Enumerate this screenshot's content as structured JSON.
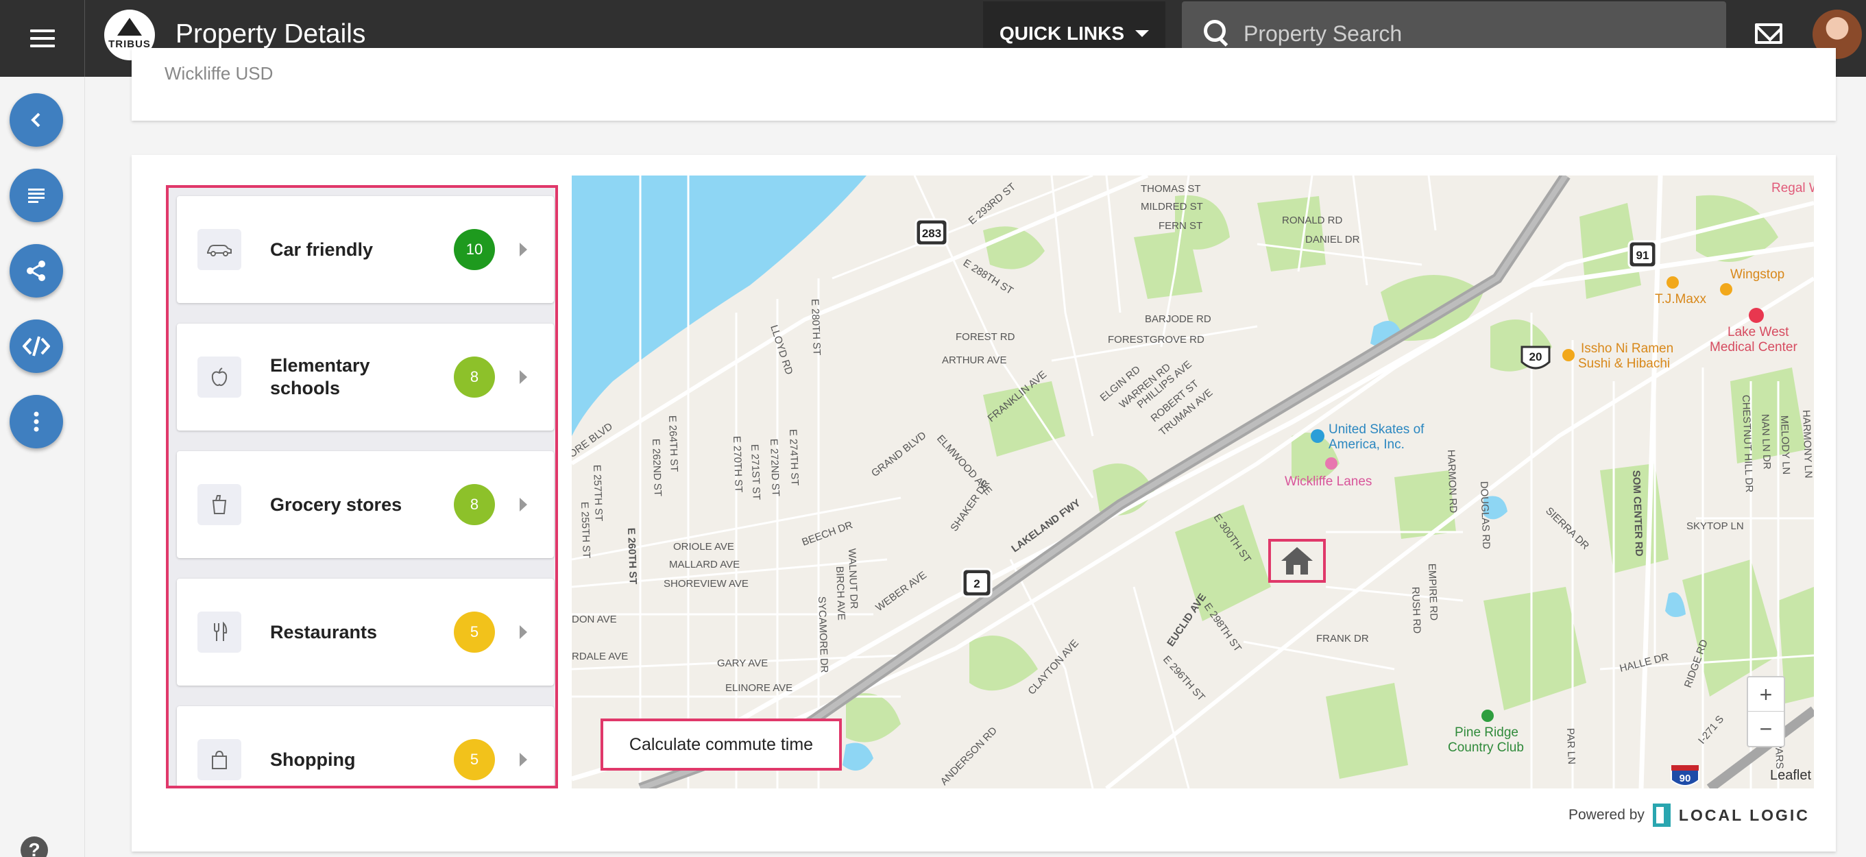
{
  "header": {
    "logo_text": "TRIBUS",
    "title": "Property Details",
    "quick_links_label": "QUICK LINKS",
    "search_placeholder": "Property Search"
  },
  "sidebar": {
    "buttons": [
      "back",
      "details",
      "share",
      "embed",
      "more"
    ]
  },
  "top_card": {
    "faded_text": "Wickliffe USD"
  },
  "categories": [
    {
      "label": "Car friendly",
      "score": "10",
      "color": "#1e9a1e",
      "icon": "car-icon"
    },
    {
      "label": "Elementary schools",
      "score": "8",
      "color": "#8dc12a",
      "icon": "apple-icon"
    },
    {
      "label": "Grocery stores",
      "score": "8",
      "color": "#8dc12a",
      "icon": "grocery-bag-icon"
    },
    {
      "label": "Restaurants",
      "score": "5",
      "color": "#f2c21b",
      "icon": "fork-knife-icon"
    },
    {
      "label": "Shopping",
      "score": "5",
      "color": "#f2c21b",
      "icon": "shopping-bag-icon"
    }
  ],
  "map": {
    "commute_button": "Calculate commute time",
    "attribution": "Leaflet",
    "zoom_in": "+",
    "zoom_out": "−",
    "highway_shields": [
      "283",
      "91",
      "20",
      "2",
      "90"
    ],
    "pois": {
      "regal": "Regal W",
      "wingstop": "Wingstop",
      "tjmaxx": "T.J.Maxx",
      "lakewest1": "Lake West",
      "lakewest2": "Medical Center",
      "issho1": "Issho Ni Ramen",
      "issho2": "Sushi & Hibachi",
      "skates1": "United Skates of",
      "skates2": "America, Inc.",
      "lanes": "Wickliffe Lanes",
      "pineridge1": "Pine Ridge",
      "pineridge2": "Country Club"
    },
    "streets": {
      "thomas": "THOMAS ST",
      "mildred": "MILDRED ST",
      "fern": "FERN ST",
      "ronald": "RONALD RD",
      "daniel": "DANIEL DR",
      "e293": "E 293RD ST",
      "e288": "E 288TH ST",
      "barjode": "BARJODE RD",
      "forest": "FOREST RD",
      "forestgrove": "FORESTGROVE RD",
      "arthur": "ARTHUR AVE",
      "franklin": "FRANKLIN AVE",
      "elgin": "ELGIN RD",
      "warren": "WARREN RD",
      "phillips": "PHILLIPS AVE",
      "robert": "ROBERT ST",
      "truman": "TRUMAN AVE",
      "lloyd": "LLOYD RD",
      "e280": "E 280TH ST",
      "grand": "GRAND BLVD",
      "elmwood": "ELMWOOD AVE",
      "shaker": "SHAKER DR",
      "lakeland": "LAKELAND FWY",
      "lakeshore": "ORE BLVD",
      "e264": "E 264TH ST",
      "e262": "E 262ND ST",
      "e270": "E 270TH ST",
      "e271": "E 271ST ST",
      "e272": "E 272ND ST",
      "e274": "E 274TH ST",
      "e257": "E 257TH ST",
      "e255": "E 255TH ST",
      "e260": "E 260TH ST",
      "oriole": "ORIOLE AVE",
      "mallard": "MALLARD AVE",
      "shoreview": "SHOREVIEW AVE",
      "beech": "BEECH DR",
      "walnut": "WALNUT DR",
      "birch": "BIRCH AVE",
      "sycamore": "SYCAMORE DR",
      "weber": "WEBER AVE",
      "gary": "GARY AVE",
      "elinore": "ELINORE AVE",
      "don": "DON AVE",
      "rdale": "RDALE AVE",
      "clayton": "CLAYTON AVE",
      "anderson": "ANDERSON RD",
      "euclid": "EUCLID AVE",
      "e300": "E 300TH ST",
      "e298": "E 298TH ST",
      "e296": "E 296TH ST",
      "frank": "FRANK DR",
      "rush": "RUSH RD",
      "empire": "EMPIRE RD",
      "harmon": "HARMON RD",
      "douglas": "DOUGLAS RD",
      "sierra": "SIERRA DR",
      "som": "SOM CENTER RD",
      "skytop": "SKYTOP LN",
      "halle": "HALLE DR",
      "ridge": "RIDGE RD",
      "i271": "I-271 S",
      "chestnut": "CHESTNUT HILL DR",
      "nan": "NAN LN DR",
      "melody": "MELODY LN",
      "harmony": "HARMONY LN",
      "parln": "PAR LN",
      "pars": "PARS"
    }
  },
  "footer": {
    "powered_by": "Powered by",
    "brand": "LOCAL LOGIC"
  }
}
